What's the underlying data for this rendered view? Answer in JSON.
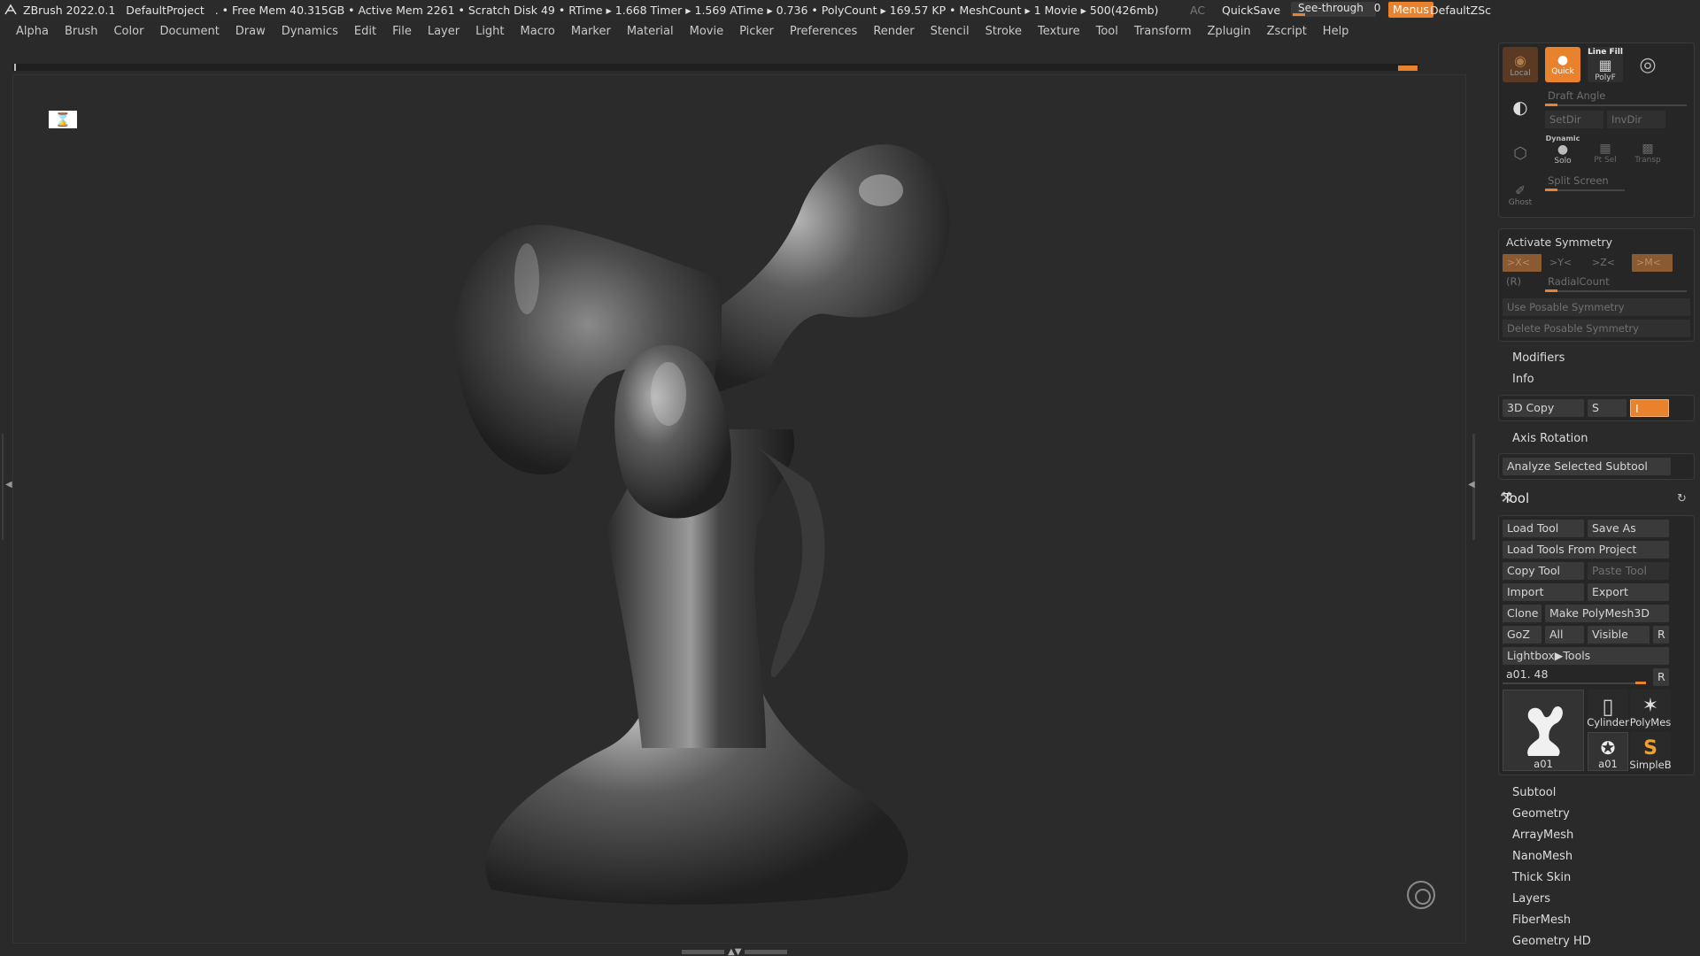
{
  "titlebar": {
    "app": "ZBrush 2022.0.1",
    "project": "DefaultProject",
    "stats": ". • Free Mem 40.315GB • Active Mem 2261 • Scratch Disk 49 •  RTime ▸ 1.668 Timer ▸ 1.569 ATime ▸ 0.736 • PolyCount ▸ 169.57 KP  • MeshCount ▸ 1  Movie ▸ 500(426mb)",
    "ac": "AC",
    "quicksave": "QuickSave",
    "seethrough_label": "See-through",
    "seethrough_value": "0",
    "menus": "Menus",
    "zscript": "DefaultZScript"
  },
  "menubar": [
    "Alpha",
    "Brush",
    "Color",
    "Document",
    "Draw",
    "Dynamics",
    "Edit",
    "File",
    "Layer",
    "Light",
    "Macro",
    "Marker",
    "Material",
    "Movie",
    "Picker",
    "Preferences",
    "Render",
    "Stencil",
    "Stroke",
    "Texture",
    "Tool",
    "Transform",
    "Zplugin",
    "Zscript",
    "Help"
  ],
  "rightpanel": {
    "tools": {
      "local": "Local",
      "quick": "Quick",
      "linefill": "Line Fill",
      "polyf": "PolyF",
      "draft_angle": "Draft Angle",
      "setdir": "SetDir",
      "invdir": "InvDir",
      "dynamic": "Dynamic",
      "solo": "Solo",
      "ptsel": "Pt Sel",
      "transp": "Transp",
      "split_screen": "Split Screen",
      "ghost": "Ghost"
    },
    "symmetry": {
      "activate": "Activate Symmetry",
      "x": ">X<",
      "y": ">Y<",
      "z": ">Z<",
      "m": ">M<",
      "r": "(R)",
      "radial": "RadialCount",
      "use_posable": "Use Posable Symmetry",
      "delete_posable": "Delete Posable Symmetry"
    },
    "modifiers": "Modifiers",
    "info": "Info",
    "copy3d": "3D Copy",
    "copy3d_s": "S",
    "copy3d_i": "I",
    "axis_rotation": "Axis Rotation",
    "analyze": "Analyze Selected Subtool",
    "tool_title": "Tool",
    "tool_buttons": {
      "load": "Load Tool",
      "saveas": "Save As",
      "loadproj": "Load Tools From Project",
      "copy": "Copy Tool",
      "paste": "Paste Tool",
      "import": "Import",
      "export": "Export",
      "clone": "Clone",
      "polymesh": "Make PolyMesh3D",
      "goz": "GoZ",
      "all": "All",
      "visible": "Visible",
      "r": "R",
      "lightbox": "Lightbox▶Tools",
      "current": "a01. 48",
      "current_r": "R"
    },
    "thumbs": {
      "main": "a01",
      "cylinder": "Cylinder",
      "polymesh": "PolyMes",
      "a01b": "a01",
      "simpleb": "SimpleB"
    },
    "sections": [
      "Subtool",
      "Geometry",
      "ArrayMesh",
      "NanoMesh",
      "Thick Skin",
      "Layers",
      "FiberMesh",
      "Geometry HD"
    ]
  },
  "colors": {
    "accent": "#e9822c",
    "panel": "#262626",
    "bg": "#2b2b2b"
  }
}
